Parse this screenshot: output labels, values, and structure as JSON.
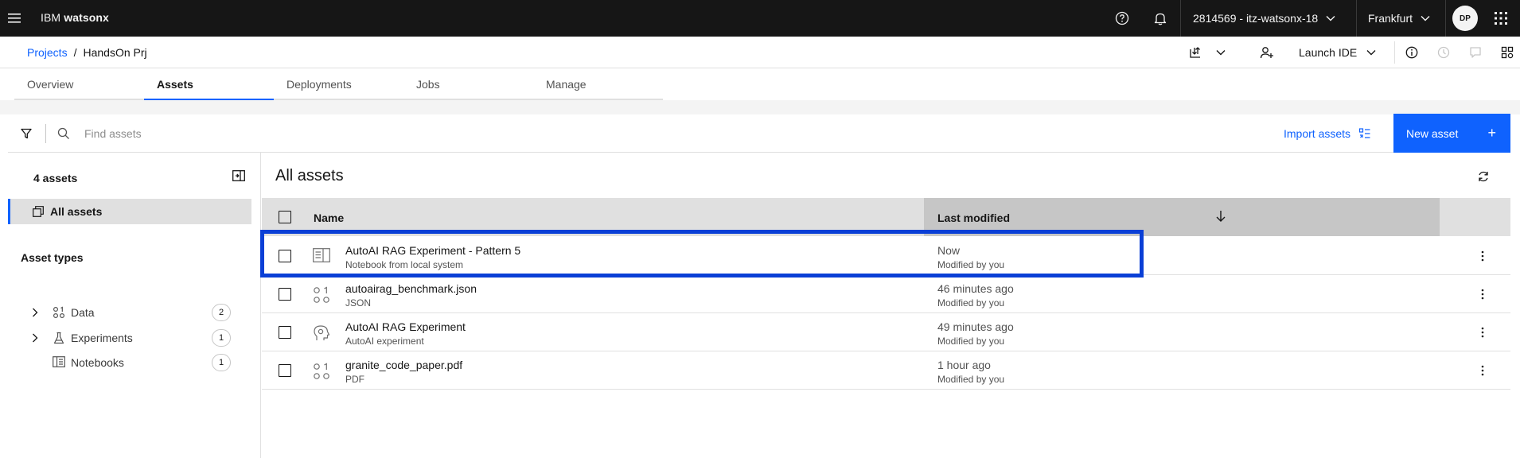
{
  "header": {
    "brand_prefix": "IBM",
    "brand_name": "watsonx",
    "account": "2814569 - itz-watsonx-18",
    "region": "Frankfurt",
    "avatar_initials": "DP"
  },
  "breadcrumb": {
    "projects": "Projects",
    "separator": "/",
    "current": "HandsOn Prj"
  },
  "toolbar_top": {
    "launch_ide": "Launch IDE"
  },
  "tabs": [
    {
      "label": "Overview",
      "active": false
    },
    {
      "label": "Assets",
      "active": true
    },
    {
      "label": "Deployments",
      "active": false
    },
    {
      "label": "Jobs",
      "active": false
    },
    {
      "label": "Manage",
      "active": false
    }
  ],
  "search": {
    "placeholder": "Find assets",
    "import_label": "Import assets",
    "new_label": "New asset"
  },
  "sidebar": {
    "count_label": "4 assets",
    "all_assets": "All assets",
    "types_title": "Asset types",
    "types": [
      {
        "label": "Data",
        "count": "2",
        "expandable": true,
        "icon": "data-icon"
      },
      {
        "label": "Experiments",
        "count": "1",
        "expandable": true,
        "icon": "flask-icon"
      },
      {
        "label": "Notebooks",
        "count": "1",
        "expandable": false,
        "icon": "notebook-icon"
      }
    ]
  },
  "main": {
    "title": "All assets",
    "columns": {
      "name": "Name",
      "modified": "Last modified"
    },
    "rows": [
      {
        "name": "AutoAI RAG Experiment - Pattern 5",
        "type": "Notebook from local system",
        "modified": "Now",
        "by": "Modified by you",
        "icon": "notebook-icon"
      },
      {
        "name": "autoairag_benchmark.json",
        "type": "JSON",
        "modified": "46 minutes ago",
        "by": "Modified by you",
        "icon": "data-icon"
      },
      {
        "name": "AutoAI RAG Experiment",
        "type": "AutoAI experiment",
        "modified": "49 minutes ago",
        "by": "Modified by you",
        "icon": "autoai-icon"
      },
      {
        "name": "granite_code_paper.pdf",
        "type": "PDF",
        "modified": "1 hour ago",
        "by": "Modified by you",
        "icon": "data-icon"
      }
    ]
  },
  "colors": {
    "header_bg": "#161616",
    "accent": "#0f62fe",
    "highlight_box": "#0a3fd6"
  }
}
